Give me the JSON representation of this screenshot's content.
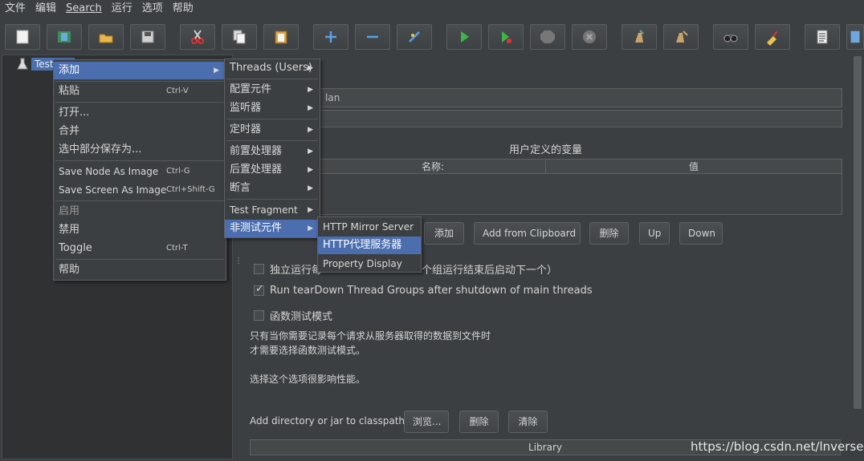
{
  "menubar": [
    "文件",
    "编辑",
    "Search",
    "运行",
    "选项",
    "帮助"
  ],
  "toolbar": [
    {
      "icon": "new-icon"
    },
    {
      "icon": "templates-icon"
    },
    {
      "icon": "open-icon"
    },
    {
      "icon": "save-icon"
    },
    {
      "icon": "cut-icon"
    },
    {
      "icon": "copy-icon"
    },
    {
      "icon": "paste-icon"
    },
    {
      "icon": "expand-icon"
    },
    {
      "icon": "collapse-icon"
    },
    {
      "icon": "toggle-icon"
    },
    {
      "icon": "start-icon"
    },
    {
      "icon": "start-no-pause-icon"
    },
    {
      "icon": "stop-icon"
    },
    {
      "icon": "shutdown-icon"
    },
    {
      "icon": "clear-icon"
    },
    {
      "icon": "clear-all-icon"
    },
    {
      "icon": "search-icon"
    },
    {
      "icon": "reset-search-icon"
    },
    {
      "icon": "function-helper-icon"
    },
    {
      "icon": "help-icon"
    }
  ],
  "tree": {
    "root_label": "Test Pl"
  },
  "context_menu": {
    "add": "添加",
    "paste": "粘贴",
    "paste_sc": "Ctrl-V",
    "open": "打开...",
    "merge": "合并",
    "save_selection": "选中部分保存为...",
    "save_node_image": "Save Node As Image",
    "save_node_image_sc": "Ctrl-G",
    "save_screen_image": "Save Screen As Image",
    "save_screen_image_sc": "Ctrl+Shift-G",
    "enable": "启用",
    "disable": "禁用",
    "toggle": "Toggle",
    "toggle_sc": "Ctrl-T",
    "help": "帮助"
  },
  "add_menu": {
    "threads": "Threads (Users)",
    "config": "配置元件",
    "listener": "监听器",
    "timer": "定时器",
    "pre": "前置处理器",
    "post": "后置处理器",
    "assert": "断言",
    "fragment": "Test Fragment",
    "non_test": "非测试元件"
  },
  "non_test_menu": {
    "mirror": "HTTP Mirror Server",
    "proxy": "HTTP代理服务器",
    "property": "Property Display"
  },
  "panel": {
    "name_value_fragment": "lan",
    "udv_title": "用户定义的变量",
    "col_name": "名称:",
    "col_value": "值",
    "btn_add": "添加",
    "btn_add_clipboard": "Add from Clipboard",
    "btn_delete": "删除",
    "btn_up": "Up",
    "btn_down": "Down",
    "cb1_label": "独立运行每",
    "cb1_label_tail": "个组运行结束后启动下一个）",
    "cb2_label": "Run tearDown Thread Groups after shutdown of main threads",
    "cb3_label": "函数测试模式",
    "desc1": "只有当你需要记录每个请求从服务器取得的数据到文件时",
    "desc2": "才需要选择函数测试模式。",
    "desc3": "选择这个选项很影响性能。",
    "classpath_label": "Add directory or jar to classpath",
    "btn_browse": "浏览...",
    "btn_cp_delete": "删除",
    "btn_clear": "清除",
    "library_header": "Library"
  },
  "watermark": "https://blog.csdn.net/lnversep",
  "colors": {
    "bg": "#3c3f41",
    "selection": "#4b6eaf",
    "tree_bg": "#2f3133"
  }
}
